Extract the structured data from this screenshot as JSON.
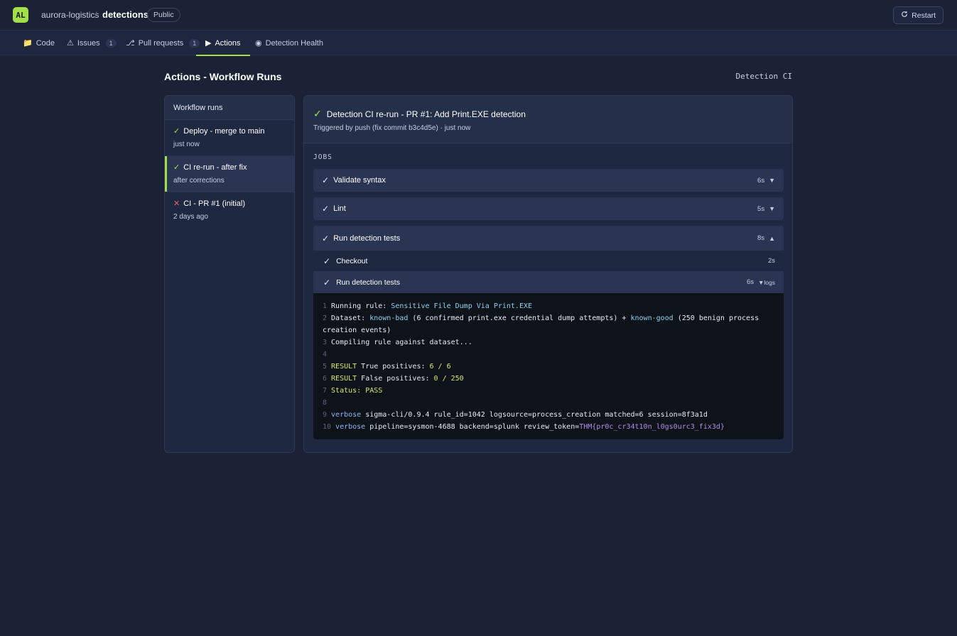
{
  "header": {
    "logo_text": "AL",
    "org": "aurora-logistics",
    "separator": "/",
    "repo": "detections",
    "visibility": "Public",
    "restart_label": "Restart"
  },
  "tabs": [
    {
      "icon": "📁",
      "label": "Code"
    },
    {
      "icon": "⚠",
      "label": "Issues",
      "count": "1"
    },
    {
      "icon": "⎇",
      "label": "Pull requests",
      "count": "1"
    },
    {
      "icon": "▶",
      "label": "Actions",
      "active": true
    },
    {
      "icon": "◉",
      "label": "Detection Health"
    }
  ],
  "page": {
    "title": "Actions - Workflow Runs",
    "workflow": "Detection CI"
  },
  "runs": {
    "header": "Workflow runs",
    "items": [
      {
        "status": "success",
        "icon": "✓",
        "title": "Deploy - merge to main",
        "sub": "just now"
      },
      {
        "status": "success",
        "icon": "✓",
        "title": "CI re-run - after fix",
        "sub": "after corrections",
        "selected": true
      },
      {
        "status": "failure",
        "icon": "✕",
        "title": "CI - PR #1 (initial)",
        "sub": "2 days ago"
      }
    ]
  },
  "detail": {
    "status_icon": "✓",
    "title": "Detection CI re-run - PR #1: Add Print.EXE detection",
    "subtitle": "Triggered by push (fix commit b3c4d5e) · just now",
    "jobs_label": "JOBS",
    "jobs": [
      {
        "icon": "✓",
        "name": "Validate syntax",
        "duration": "6s",
        "chevron": "▼"
      },
      {
        "icon": "✓",
        "name": "Lint",
        "duration": "5s",
        "chevron": "▼"
      },
      {
        "icon": "✓",
        "name": "Run detection tests",
        "duration": "8s",
        "chevron": "▲"
      }
    ],
    "steps": [
      {
        "icon": "✓",
        "name": "Checkout",
        "duration": "2s"
      },
      {
        "icon": "✓",
        "name": "Run detection tests",
        "duration": "6s",
        "logs_label": "▼logs"
      }
    ],
    "log": {
      "l1_num": "1",
      "l1_a": "Running rule: ",
      "l1_b": "Sensitive File Dump Via Print.EXE",
      "l2_num": "2",
      "l2_a": "Dataset: ",
      "l2_b": "known-bad",
      "l2_c": " (6 confirmed print.exe credential dump attempts) + ",
      "l2_d": "known-good",
      "l2_e": " (250 benign process",
      "l2_wrap": "creation events)",
      "l3_num": "3",
      "l3_a": "Compiling rule against dataset...",
      "l4_num": "4",
      "l5_num": "5",
      "l5_a": "RESULT",
      "l5_b": " True positives: ",
      "l5_c": "6 / 6",
      "l6_num": "6",
      "l6_a": "RESULT",
      "l6_b": " False positives: ",
      "l6_c": "0 / 250",
      "l7_num": "7",
      "l7_a": "Status: PASS",
      "l8_num": "8",
      "l9_num": "9",
      "l9_a": "verbose",
      "l9_b": " sigma-cli/0.9.4 rule_id=1042 logsource=process_creation matched=6 session=8f3a1d",
      "l10_num": "10",
      "l10_a": "verbose",
      "l10_b": " pipeline=sysmon-4688 backend=splunk review_token=",
      "l10_c": "THM{pr0c_cr34t10n_l0gs0urc3_fix3d}"
    }
  },
  "colors": {
    "background": "#1b2236",
    "accent": "#a3e048",
    "failure": "#e0655a",
    "panel": "#1f2841"
  }
}
